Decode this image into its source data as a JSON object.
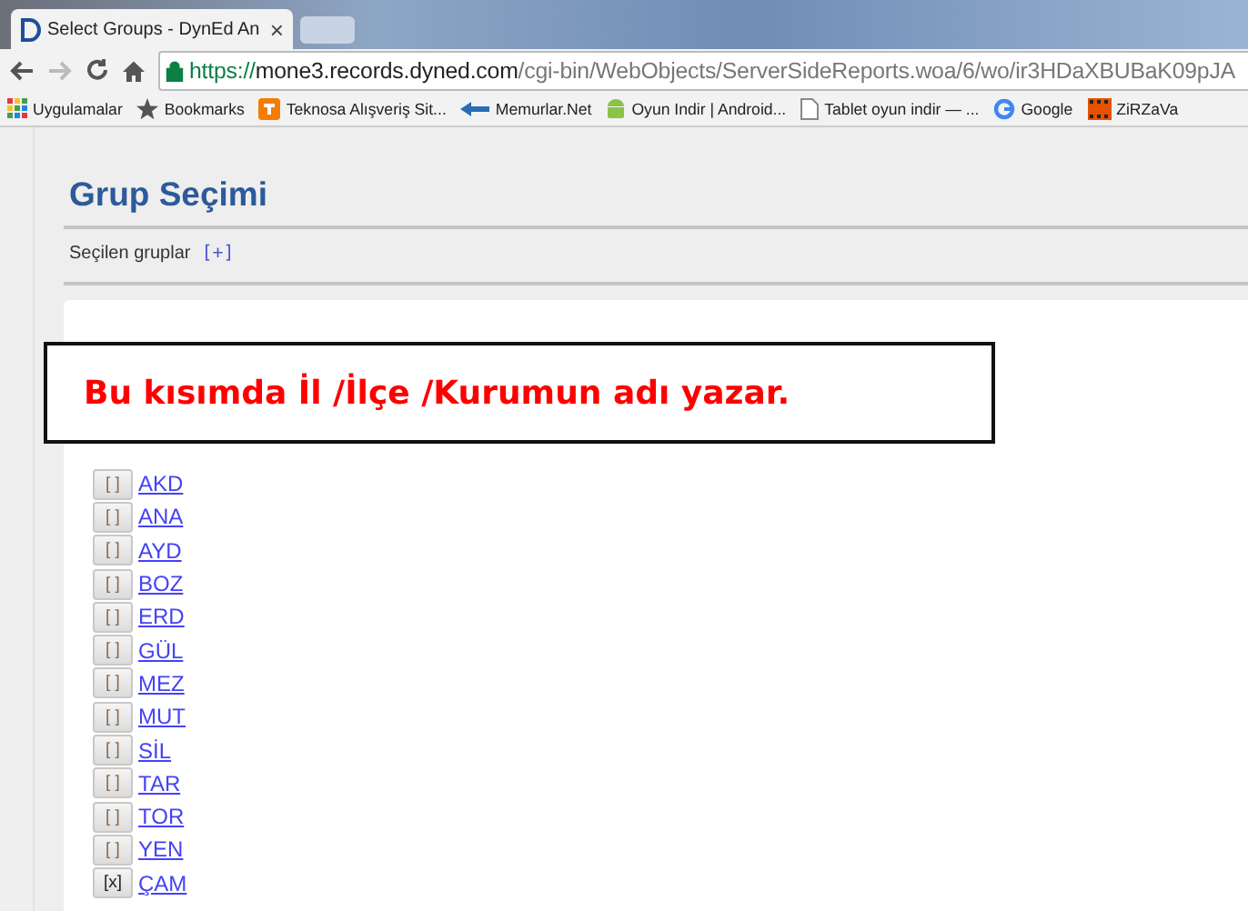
{
  "browser": {
    "tab_title": "Select Groups - DynEd An",
    "tab_close": "×",
    "address": {
      "scheme": "https://",
      "host": "mone3.records.dyned.com",
      "path": "/cgi-bin/WebObjects/ServerSideReports.woa/6/wo/ir3HDaXBUBaK09pJA"
    },
    "bookmarks": [
      {
        "label": "Uygulamalar",
        "kind": "apps"
      },
      {
        "label": "Bookmarks",
        "kind": "star"
      },
      {
        "label": "Teknosa Alışveriş Sit...",
        "kind": "orange"
      },
      {
        "label": "Memurlar.Net",
        "kind": "blue"
      },
      {
        "label": "Oyun Indir | Android...",
        "kind": "android"
      },
      {
        "label": "Tablet oyun indir — ...",
        "kind": "page"
      },
      {
        "label": "Google",
        "kind": "google"
      },
      {
        "label": "ZiRZaVa",
        "kind": "film"
      }
    ]
  },
  "page": {
    "title": "Grup Seçimi",
    "selected_label": "Seçilen gruplar",
    "add_link": "[+]"
  },
  "callout": "Bu kısımda İl /İlçe /Kurumun adı yazar.",
  "groups": [
    {
      "toggle": "[ ]",
      "name": "AKD",
      "selected": false
    },
    {
      "toggle": "[ ]",
      "name": "ANA",
      "selected": false
    },
    {
      "toggle": "[ ]",
      "name": "AYD",
      "selected": false
    },
    {
      "toggle": "[ ]",
      "name": "BOZ",
      "selected": false
    },
    {
      "toggle": "[ ]",
      "name": "ERD",
      "selected": false
    },
    {
      "toggle": "[ ]",
      "name": "GÜL",
      "selected": false
    },
    {
      "toggle": "[ ]",
      "name": "MEZ",
      "selected": false
    },
    {
      "toggle": "[ ]",
      "name": "MUT",
      "selected": false
    },
    {
      "toggle": "[ ]",
      "name": "SİL",
      "selected": false
    },
    {
      "toggle": "[ ]",
      "name": "TAR",
      "selected": false
    },
    {
      "toggle": "[ ]",
      "name": "TOR",
      "selected": false
    },
    {
      "toggle": "[ ]",
      "name": "YEN",
      "selected": false
    },
    {
      "toggle": "[x]",
      "name": "ÇAM",
      "selected": true
    }
  ]
}
